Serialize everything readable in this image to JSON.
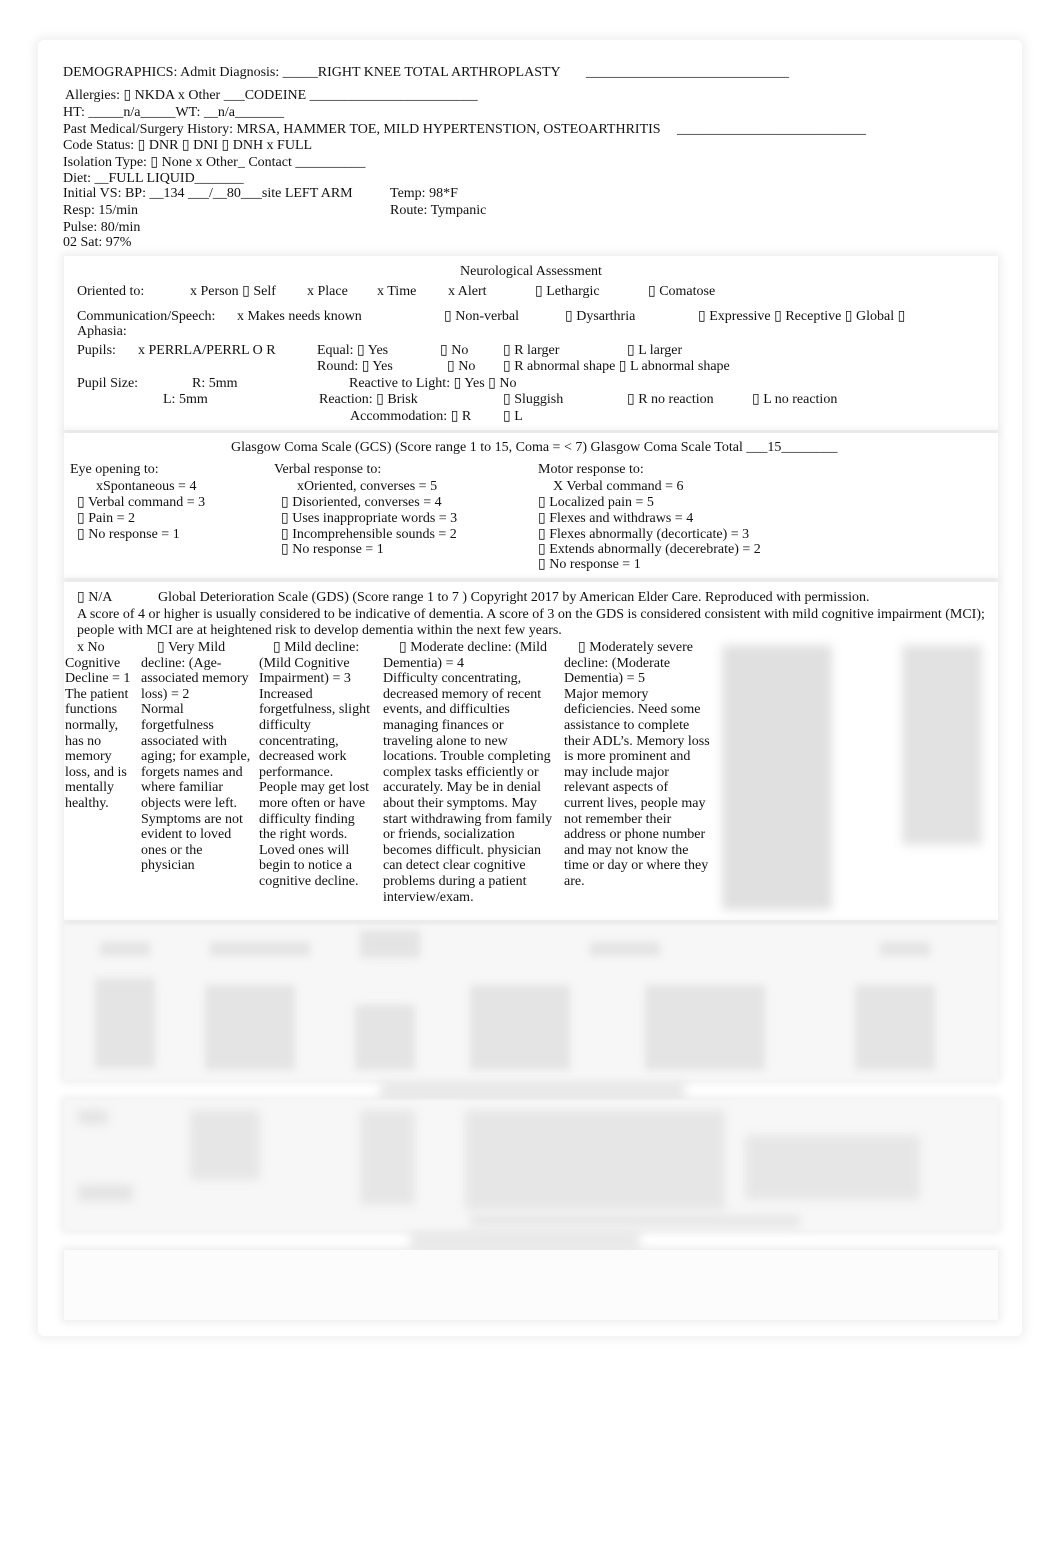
{
  "demographics": {
    "admit_dx": "DEMOGRAPHICS: Admit Diagnosis: _____RIGHT KNEE TOTAL ARTHROPLASTY",
    "admit_blank": "_____________________________",
    "allergies": "Allergies:  ▯ NKDA x  Other ___CODEINE  ________________________",
    "ht_wt": "HT:  _____n/a_____WT:   __n/a_______",
    "history": "Past  Medical/Surgery     History: MRSA, HAMMER TOE, MILD HYPERTENSTION, OSTEOARTHRITIS",
    "history_blank": "___________________________",
    "code_status": "Code Status:  ▯  DNR ▯  DNI ▯  DNH x  FULL",
    "isolation": "Isolation Type:   ▯ None  x  Other_ Contact  __________",
    "diet": "Diet: __FULL LIQUID_______",
    "initial_vs": "Initial VS: BP: __134 ___/__80___site LEFT ARM",
    "temp": "Temp: 98*F",
    "resp": "Resp: 15/min",
    "route": "Route: Tympanic",
    "pulse": "Pulse: 80/min",
    "o2": "02 Sat: 97%"
  },
  "neuro": {
    "title": "Neurological Assessment",
    "oriented_label": "Oriented to:",
    "oriented_items": [
      "x Person ▯ Self",
      "x Place",
      "x Time",
      "x Alert",
      "▯  Lethargic",
      "▯  Comatose"
    ],
    "comm_label": "Communication/Speech:",
    "comm_items": [
      "x Makes needs known",
      "▯  Non-verbal",
      "▯  Dysarthria",
      "▯  Expressive ▯  Receptive ▯  Global ▯"
    ],
    "aphasia": "Aphasia:",
    "pupils_label": "Pupils:",
    "pupils_perrla": "x PERRLA/PERRL     O  R",
    "equal": "Equal: ▯  Yes",
    "equal_no": "▯  No",
    "r_larger": "▯  R larger",
    "l_larger": "▯  L larger",
    "round": "Round: ▯  Yes",
    "round_no": "▯  No",
    "r_abnormal": "▯  R abnormal shape ▯  L abnormal shape",
    "pupil_size_label": "Pupil Size:",
    "r_size": "R: 5mm",
    "l_size": "L: 5mm",
    "reactive": "Reactive to Light: ▯  Yes ▯  No",
    "reaction": "Reaction:  ▯  Brisk",
    "sluggish": "▯  Sluggish",
    "r_no_reaction": "▯  R no reaction",
    "l_no_reaction": "▯  L no reaction",
    "accommodation": "Accommodation:  ▯  R",
    "accommodation_l": "▯  L"
  },
  "gcs": {
    "title": "Glasgow Coma Scale (GCS)   (Score range 1 to 15, Coma = < 7) Glasgow Coma Scale  Total ___15________",
    "eye": {
      "label": "Eye opening to:",
      "items": [
        "xSpontaneous = 4",
        "▯   Verbal command = 3",
        "▯   Pain = 2",
        "▯   No response = 1"
      ]
    },
    "verbal": {
      "label": "Verbal response to:",
      "items": [
        "xOriented, converses = 5",
        "▯   Disoriented, converses = 4",
        "▯   Uses inappropriate words = 3",
        "▯   Incomprehensible sounds = 2",
        "▯   No response = 1"
      ]
    },
    "motor": {
      "label": "Motor response to:",
      "items": [
        "X Verbal command = 6",
        "▯   Localized pain = 5",
        "▯   Flexes and withdraws = 4",
        "▯   Flexes abnormally (decorticate) = 3",
        "▯   Extends abnormally (decerebrate) = 2",
        "▯   No response = 1"
      ]
    }
  },
  "gds": {
    "na": "▯  N/A",
    "title": "Global Deterioration Scale (GDS)    (Score range 1 to 7 ) Copyright 2017 by American Elder Care. Reproduced with permission.",
    "desc1": "A score of 4 or higher is usually considered to be indicative of dementia. A score of 3 on the GDS is considered consistent with mild cognitive impairment (MCI);",
    "desc2": "people with MCI are at heightened risk to develop dementia within the next few years.",
    "columns": [
      {
        "head": "x No Cognitive Decline = 1",
        "body": "The patient functions normally, has no memory loss, and is mentally healthy."
      },
      {
        "head": "▯  Very Mild decline: (Age-associated memory loss) = 2",
        "body": "Normal forgetfulness associated with aging; for example, forgets names and where familiar objects were left. Symptoms are not evident to loved ones or the physician"
      },
      {
        "head": "▯  Mild decline: (Mild Cognitive Impairment) = 3",
        "body": "Increased forgetfulness, slight difficulty concentrating, decreased work performance. People may get lost more often or have difficulty finding the right words. Loved ones will begin to notice a cognitive decline."
      },
      {
        "head": "▯  Moderate decline: (Mild Dementia) = 4",
        "body": "Difficulty concentrating, decreased memory of recent events, and difficulties managing finances or traveling alone to new locations. Trouble completing complex tasks efficiently or accurately. May be in denial about their symptoms. May start withdrawing from family or friends, socialization becomes difficult. physician can detect clear cognitive problems during a patient interview/exam."
      },
      {
        "head": "▯  Moderately severe decline: (Moderate Dementia) = 5",
        "body": "Major memory deficiencies. Need some assistance to complete their ADL’s. Memory loss is more prominent and may include major relevant aspects of current lives, people may not remember their address or phone number and may not know the time or day or where they are."
      }
    ]
  }
}
